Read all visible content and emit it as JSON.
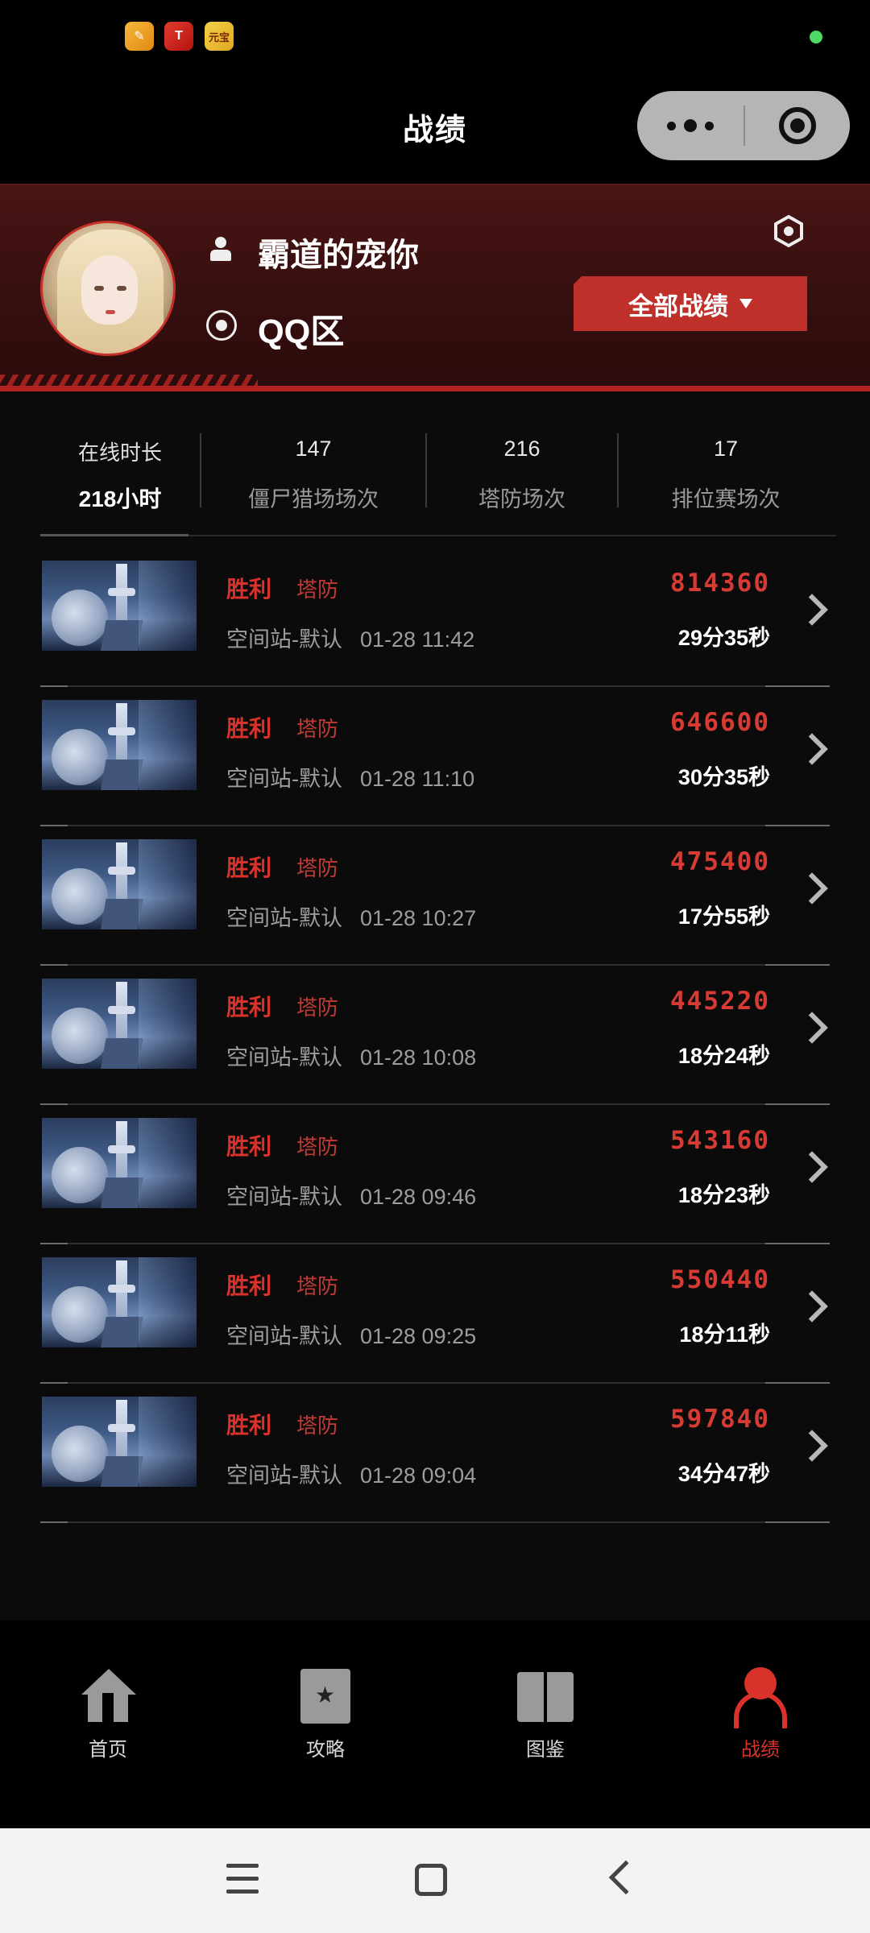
{
  "status_bar": {
    "app_icons": [
      "notes-app-icon",
      "t-app-icon",
      "game-app-icon"
    ],
    "app3_text": "元宝"
  },
  "header": {
    "title": "战绩"
  },
  "profile": {
    "username": "霸道的宠你",
    "region": "QQ区",
    "filter_label": "全部战绩"
  },
  "stats": [
    {
      "top": "在线时长",
      "bottom": "218小时"
    },
    {
      "top": "147",
      "bottom": "僵尸猎场场次"
    },
    {
      "top": "216",
      "bottom": "塔防场次"
    },
    {
      "top": "17",
      "bottom": "排位赛场次"
    }
  ],
  "battles": [
    {
      "result": "胜利",
      "mode": "塔防",
      "map": "空间站-默认",
      "time": "01-28 11:42",
      "score": "814360",
      "duration": "29分35秒"
    },
    {
      "result": "胜利",
      "mode": "塔防",
      "map": "空间站-默认",
      "time": "01-28 11:10",
      "score": "646600",
      "duration": "30分35秒"
    },
    {
      "result": "胜利",
      "mode": "塔防",
      "map": "空间站-默认",
      "time": "01-28 10:27",
      "score": "475400",
      "duration": "17分55秒"
    },
    {
      "result": "胜利",
      "mode": "塔防",
      "map": "空间站-默认",
      "time": "01-28 10:08",
      "score": "445220",
      "duration": "18分24秒"
    },
    {
      "result": "胜利",
      "mode": "塔防",
      "map": "空间站-默认",
      "time": "01-28 09:46",
      "score": "543160",
      "duration": "18分23秒"
    },
    {
      "result": "胜利",
      "mode": "塔防",
      "map": "空间站-默认",
      "time": "01-28 09:25",
      "score": "550440",
      "duration": "18分11秒"
    },
    {
      "result": "胜利",
      "mode": "塔防",
      "map": "空间站-默认",
      "time": "01-28 09:04",
      "score": "597840",
      "duration": "34分47秒"
    }
  ],
  "tabs": [
    {
      "label": "首页",
      "icon": "home-icon"
    },
    {
      "label": "攻略",
      "icon": "guide-book-icon"
    },
    {
      "label": "图鉴",
      "icon": "open-book-icon"
    },
    {
      "label": "战绩",
      "icon": "user-record-icon",
      "active": true
    }
  ],
  "colors": {
    "accent": "#d8322b",
    "background": "#0b0b0c",
    "header_bg": "#3a1010"
  }
}
